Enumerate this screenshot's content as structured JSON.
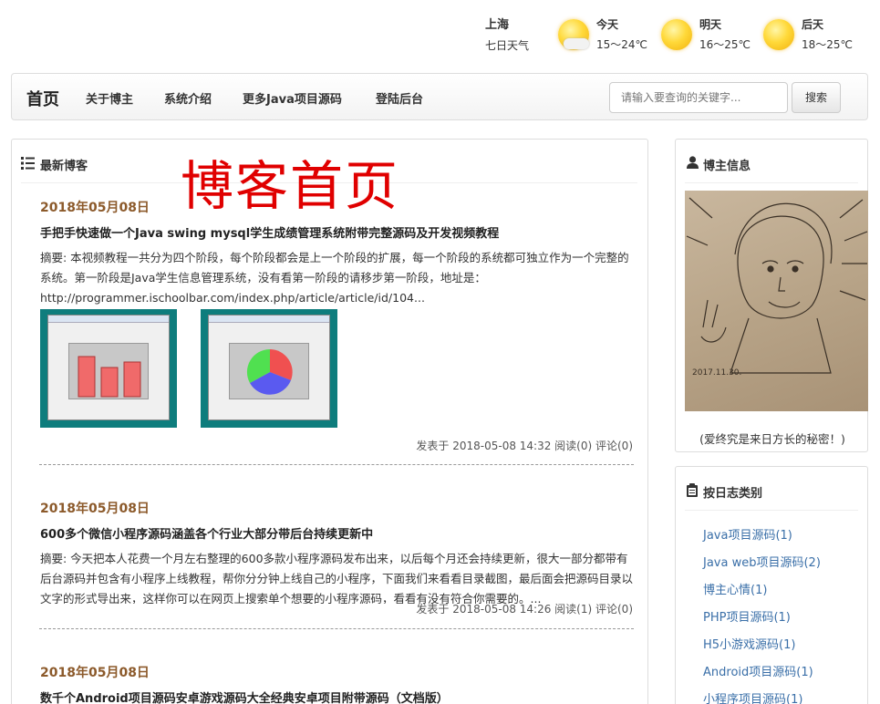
{
  "weather": {
    "city": "上海",
    "subtitle": "七日天气",
    "days": [
      {
        "label": "今天",
        "temp": "15～24℃",
        "icon": "partly-sunny-icon"
      },
      {
        "label": "明天",
        "temp": "16～25℃",
        "icon": "sunny-icon"
      },
      {
        "label": "后天",
        "temp": "18～25℃",
        "icon": "sunny-icon"
      }
    ]
  },
  "nav": {
    "brand": "首页",
    "links": [
      "关于博主",
      "系统介绍",
      "更多Java项目源码",
      "登陆后台"
    ],
    "search_placeholder": "请输入要查询的关键字...",
    "search_button": "搜索"
  },
  "main": {
    "section_title": "最新博客",
    "overlay_title": "博客首页",
    "posts": [
      {
        "date": "2018年05月08日",
        "title": "手把手快速做一个Java swing mysql学生成绩管理系统附带完整源码及开发视频教程",
        "summary": "摘要: 本视频教程一共分为四个阶段，每个阶段都会是上一个阶段的扩展，每一个阶段的系统都可独立作为一个完整的系统。第一阶段是Java学生信息管理系统，没有看第一阶段的请移步第一阶段，地址是：http://programmer.ischoolbar.com/index.php/article/article/id/104...",
        "meta": "发表于 2018-05-08 14:32 阅读(0) 评论(0)"
      },
      {
        "date": "2018年05月08日",
        "title": "600多个微信小程序源码涵盖各个行业大部分带后台持续更新中",
        "summary": "摘要: 今天把本人花费一个月左右整理的600多款小程序源码发布出来，以后每个月还会持续更新，很大一部分都带有后台源码并包含有小程序上线教程，帮你分分钟上线自己的小程序，下面我们来看看目录截图，最后面会把源码目录以文字的形式导出来，这样你可以在网页上搜索单个想要的小程序源码，看看有没有符合你需要的。...",
        "meta": "发表于 2018-05-08 14:26 阅读(1) 评论(0)"
      },
      {
        "date": "2018年05月08日",
        "title": "数千个Android项目源码安卓游戏源码大全经典安卓项目附带源码（文档版）",
        "summary": "",
        "meta": ""
      }
    ]
  },
  "sidebar": {
    "blogger_title": "博主信息",
    "portrait_date": "2017.11.30.",
    "motto": "(爱终究是来日方长的秘密！)",
    "category_title": "按日志类别",
    "categories": [
      "Java项目源码(1)",
      "Java web项目源码(2)",
      "博主心情(1)",
      "PHP项目源码(1)",
      "H5小游戏源码(1)",
      "Android项目源码(1)",
      "小程序项目源码(1)"
    ]
  }
}
